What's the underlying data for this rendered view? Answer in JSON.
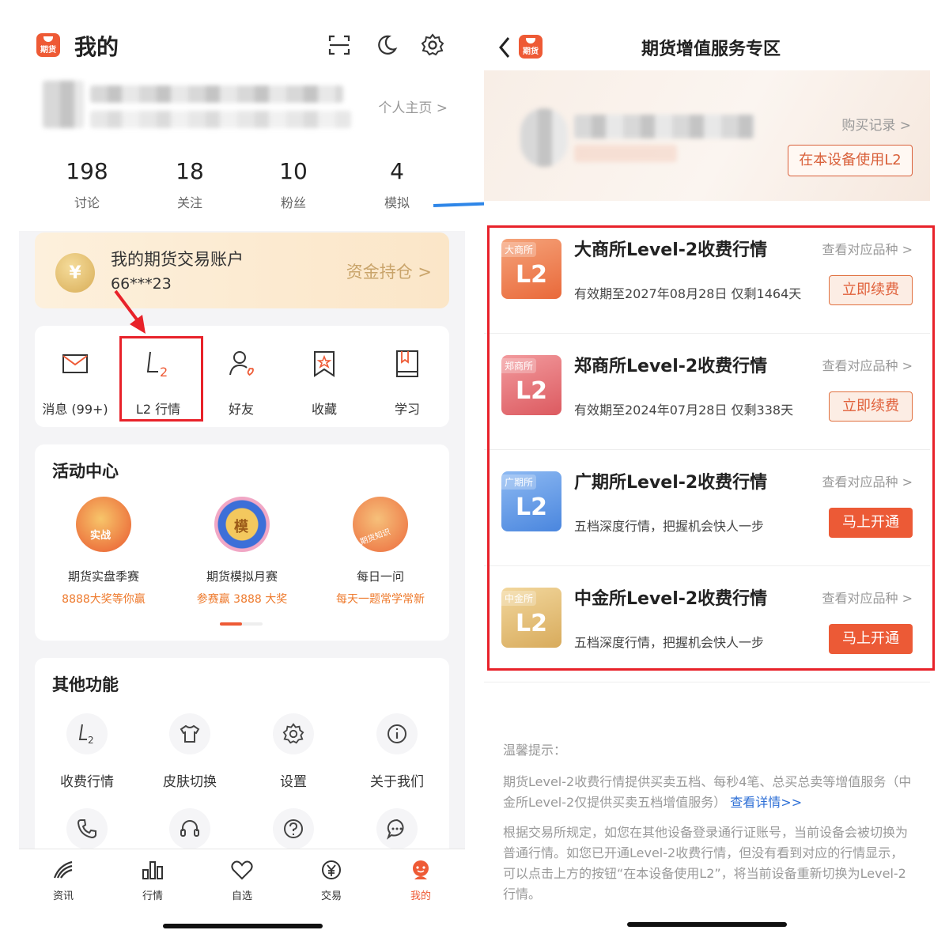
{
  "left": {
    "header": {
      "logo_text": "期货",
      "title": "我的"
    },
    "profile": {
      "homepage_link": "个人主页 >"
    },
    "stats": [
      {
        "value": "198",
        "label": "讨论"
      },
      {
        "value": "18",
        "label": "关注"
      },
      {
        "value": "10",
        "label": "粉丝"
      },
      {
        "value": "4",
        "label": "模拟"
      }
    ],
    "account": {
      "icon": "¥",
      "title": "我的期货交易账户",
      "number": "66***23",
      "link": "资金持仓 >"
    },
    "quick_items": [
      {
        "label": "消息 (99+)",
        "icon": "mail-icon"
      },
      {
        "label": "L2 行情",
        "icon": "l2-icon"
      },
      {
        "label": "好友",
        "icon": "friend-icon"
      },
      {
        "label": "收藏",
        "icon": "bookmark-icon"
      },
      {
        "label": "学习",
        "icon": "book-icon"
      }
    ],
    "activity": {
      "title": "活动中心",
      "items": [
        {
          "name": "期货实盘季赛",
          "sub": "8888大奖等你赢",
          "badge_text": "实战"
        },
        {
          "name": "期货模拟月赛",
          "sub": "参赛赢 3888 大奖",
          "badge_text": "模"
        },
        {
          "name": "每日一问",
          "sub": "每天一题常学常新",
          "badge_text": "期货知识"
        }
      ]
    },
    "other": {
      "title": "其他功能",
      "items": [
        {
          "label": "收费行情",
          "icon": "l2-icon"
        },
        {
          "label": "皮肤切换",
          "icon": "shirt-icon"
        },
        {
          "label": "设置",
          "icon": "gear-icon"
        },
        {
          "label": "关于我们",
          "icon": "info-icon"
        }
      ],
      "row2_icons": [
        "phone-icon",
        "headset-icon",
        "help-icon",
        "chat-icon"
      ]
    },
    "tabs": [
      {
        "label": "资讯",
        "icon": "news-icon"
      },
      {
        "label": "行情",
        "icon": "chart-icon"
      },
      {
        "label": "自选",
        "icon": "heart-icon"
      },
      {
        "label": "交易",
        "icon": "yen-icon"
      },
      {
        "label": "我的",
        "icon": "mine-icon",
        "active": true
      }
    ]
  },
  "right": {
    "header": {
      "logo_text": "期货",
      "title": "期货增值服务专区"
    },
    "banner": {
      "buy_record": "购买记录 >",
      "use_button": "在本设备使用L2"
    },
    "services": [
      {
        "exchange": "大商所",
        "badge": "L2",
        "title": "大商所Level-2收费行情",
        "link": "查看对应品种 >",
        "desc": "有效期至2027年08月28日 仅剩1464天",
        "button": "立即续费",
        "button_type": "renew",
        "color": "#ec7c4b"
      },
      {
        "exchange": "郑商所",
        "badge": "L2",
        "title": "郑商所Level-2收费行情",
        "link": "查看对应品种 >",
        "desc": "有效期至2024年07月28日 仅剩338天",
        "button": "立即续费",
        "button_type": "renew",
        "color": "#e2676c"
      },
      {
        "exchange": "广期所",
        "badge": "L2",
        "title": "广期所Level-2收费行情",
        "link": "查看对应品种 >",
        "desc": "五档深度行情，把握机会快人一步",
        "button": "马上开通",
        "button_type": "open",
        "color": "#4f88de"
      },
      {
        "exchange": "中金所",
        "badge": "L2",
        "title": "中金所Level-2收费行情",
        "link": "查看对应品种 >",
        "desc": "五档深度行情，把握机会快人一步",
        "button": "马上开通",
        "button_type": "open",
        "color": "#dbb064"
      }
    ],
    "tips": {
      "title": "温馨提示：",
      "para1": "期货Level-2收费行情提供买卖五档、每秒4笔、总买总卖等增值服务（中金所Level-2仅提供买卖五档增值服务）",
      "para1_link": "查看详情>>",
      "para2": "根据交易所规定，如您在其他设备登录通行证账号，当前设备会被切换为普通行情。如您已开通Level-2收费行情，但没有看到对应的行情显示，可以点击上方的按钮“在本设备使用L2”，将当前设备重新切换为Level-2行情。"
    }
  },
  "colors": {
    "accent": "#ec5a36",
    "highlight_red": "#e8222a",
    "arrow_blue": "#2e86e8"
  }
}
